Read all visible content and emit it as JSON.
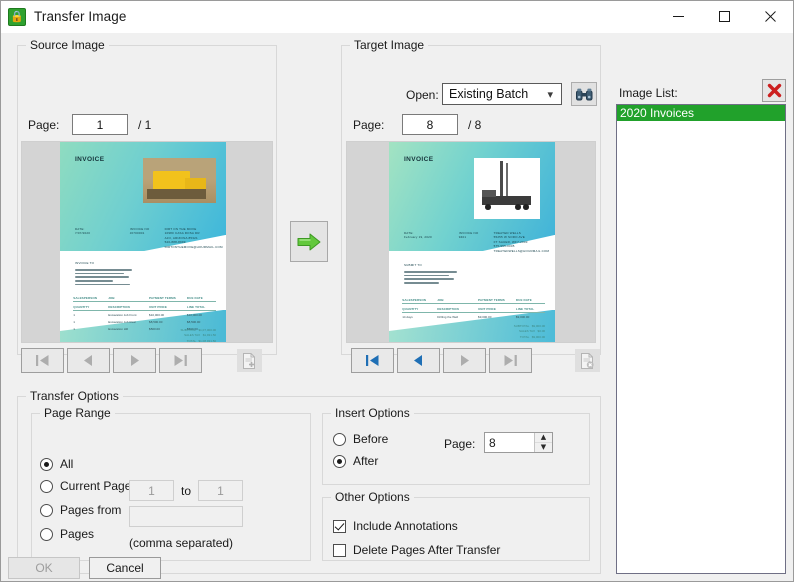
{
  "window": {
    "title": "Transfer Image",
    "icon": "app-lock-icon",
    "minimize_label": "—",
    "maximize_label": "☐",
    "close_label": "✕"
  },
  "source": {
    "group_title": "Source Image",
    "page_label": "Page:",
    "page_value": "1",
    "page_total": "/ 1",
    "nav": [
      {
        "name": "first",
        "glyph": "first-page-icon",
        "enabled": false
      },
      {
        "name": "previous",
        "glyph": "previous-page-icon",
        "enabled": false
      },
      {
        "name": "next",
        "glyph": "next-page-icon",
        "enabled": false
      },
      {
        "name": "last",
        "glyph": "last-page-icon",
        "enabled": false
      }
    ],
    "action_icon": "add-page-icon",
    "action_enabled": false,
    "preview": {
      "title": "INVOICE",
      "date_label": "DATE:",
      "date_value": "7/07/2020",
      "invoice_no_label": "INVOICE NO",
      "invoice_no_value": "J0700001",
      "company_lines": [
        "DIRT ON THE MOVE",
        "10980 CASA ROSA DR",
        "AJO, ARIZONA 85321",
        "520-888-8999",
        "DIRTONTHEMOVE@HOURMAIL.COM"
      ],
      "bill_to_label": "INVOICE TO",
      "table_headers_1": [
        "SALESPERSON",
        "JOB",
        "PAYMENT TERMS",
        "DUE DATE"
      ],
      "table_headers_2": [
        "QUANTITY",
        "DESCRIPTION",
        "UNIT PRICE",
        "LINE TOTAL"
      ],
      "rows": [
        {
          "qty": "1",
          "desc": "Excavation Job Front",
          "unit": "$10,000.00",
          "total": "$10,000.00"
        },
        {
          "qty": "1",
          "desc": "Excavation Job Rear",
          "unit": "$8,500.00",
          "total": "$8,500.00"
        },
        {
          "qty": "1",
          "desc": "Excavation Hill",
          "unit": "$500.00",
          "total": "$500.00"
        }
      ],
      "totals": [
        {
          "label": "SUBTOTAL",
          "value": "$1,07,000.00"
        },
        {
          "label": "SALES TAX",
          "value": "$1,931.50"
        },
        {
          "label": "TOTAL",
          "value": "$1,08,931.50"
        }
      ]
    }
  },
  "target": {
    "group_title": "Target Image",
    "open_label": "Open:",
    "open_value": "Existing Batch",
    "open_options": [
      "Existing Batch"
    ],
    "browse_icon": "binoculars-icon",
    "page_label": "Page:",
    "page_value": "8",
    "page_total": "/ 8",
    "nav": [
      {
        "name": "first",
        "glyph": "first-page-icon",
        "enabled": true
      },
      {
        "name": "previous",
        "glyph": "previous-page-icon",
        "enabled": true
      },
      {
        "name": "next",
        "glyph": "next-page-icon",
        "enabled": false
      },
      {
        "name": "last",
        "glyph": "last-page-icon",
        "enabled": false
      }
    ],
    "action_icon": "delete-page-icon",
    "action_enabled": false,
    "preview": {
      "title": "INVOICE",
      "date_label": "DATE:",
      "date_value": "February 19, 2020",
      "invoice_no_label": "INVOICE NO",
      "invoice_no_value": "9401",
      "company_lines": [
        "TREATED WELLS",
        "55255 W SORO AVE",
        "FT SAUER, WF7-2003",
        "575-955-0005",
        "TREATEDWELLS@HOURMAIL.COM"
      ],
      "bill_to_label": "SUBMIT TO",
      "table_headers_1": [
        "SALESPERSON",
        "JOB",
        "PAYMENT TERMS",
        "DUE DATE"
      ],
      "table_headers_2": [
        "QUANTITY",
        "DESCRIPTION",
        "UNIT PRICE",
        "LINE TOTAL"
      ],
      "rows": [
        {
          "qty": "14 days",
          "desc": "Drilling the Well",
          "unit": "$9,000.00",
          "total": "$9,000.00"
        }
      ],
      "totals": [
        {
          "label": "SUBTOTAL",
          "value": "$9,000.00"
        },
        {
          "label": "SALES TAX",
          "value": "$0.00"
        },
        {
          "label": "TOTAL",
          "value": "$9,000.00"
        }
      ]
    }
  },
  "transfer_button": {
    "name": "transfer-arrow-button",
    "icon": "right-arrow-icon",
    "color": "#5bc236"
  },
  "image_list": {
    "label": "Image List:",
    "delete_icon": "red-x-delete-icon",
    "items": [
      {
        "label": "2020 Invoices",
        "selected": true
      }
    ],
    "selection_color": "#21a12b"
  },
  "transfer_options": {
    "group_title": "Transfer Options",
    "page_range": {
      "group_title": "Page Range",
      "options": [
        {
          "label": "All",
          "selected": true
        },
        {
          "label": "Current Page",
          "selected": false
        },
        {
          "label": "Pages from",
          "selected": false
        },
        {
          "label": "Pages",
          "selected": false
        }
      ],
      "from_value": "1",
      "to_label": "to",
      "to_value": "1",
      "pages_value": "",
      "hint": "(comma separated)"
    },
    "insert_options": {
      "group_title": "Insert Options",
      "options": [
        {
          "label": "Before",
          "selected": false
        },
        {
          "label": "After",
          "selected": true
        }
      ],
      "page_label": "Page:",
      "page_value": "8"
    },
    "other_options": {
      "group_title": "Other Options",
      "checkboxes": [
        {
          "label": "Include Annotations",
          "checked": true
        },
        {
          "label": "Delete Pages After Transfer",
          "checked": false
        }
      ]
    }
  },
  "footer": {
    "ok_label": "OK",
    "ok_enabled": false,
    "cancel_label": "Cancel",
    "cancel_enabled": true
  }
}
